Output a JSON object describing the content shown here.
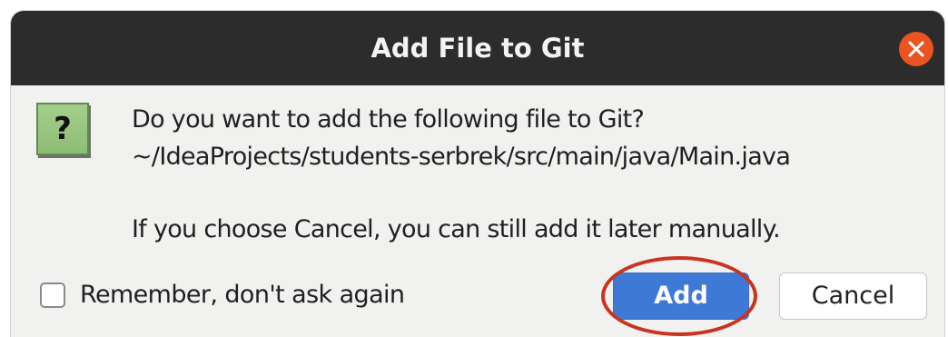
{
  "dialog": {
    "title": "Add File to Git",
    "message_line_1": "Do you want to add the following file to Git?",
    "message_line_2": "~/IdeaProjects/students-serbrek/src/main/java/Main.java",
    "message_line_3": "If you choose Cancel, you can still add it later manually.",
    "question_glyph": "?",
    "remember_label": "Remember, don't ask again",
    "remember_checked": false,
    "add_label": "Add",
    "cancel_label": "Cancel"
  },
  "icons": {
    "close": "close-icon",
    "question": "question-icon"
  },
  "colors": {
    "titlebar": "#2c2c2c",
    "close_button": "#e95420",
    "primary_button": "#3f79d6",
    "highlight_ring": "#c8341f",
    "question_icon": "#9cc783"
  }
}
